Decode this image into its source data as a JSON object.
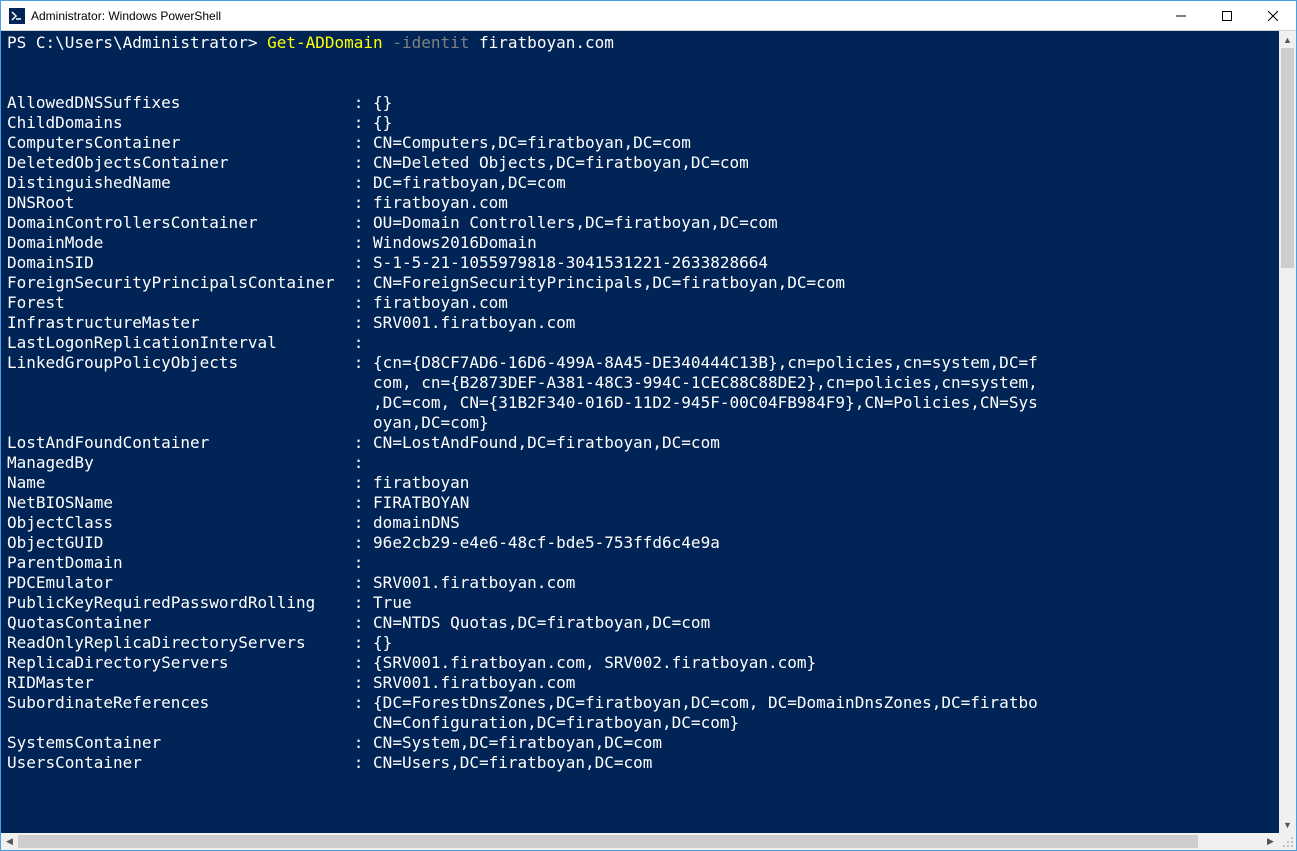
{
  "window": {
    "title": "Administrator: Windows PowerShell"
  },
  "prompt": {
    "prefix": "PS C:\\Users\\Administrator> ",
    "command": "Get-ADDomain",
    "param_flag": " -identit ",
    "argument": "firatboyan.com"
  },
  "properties": [
    {
      "name": "AllowedDNSSuffixes",
      "value": "{}"
    },
    {
      "name": "ChildDomains",
      "value": "{}"
    },
    {
      "name": "ComputersContainer",
      "value": "CN=Computers,DC=firatboyan,DC=com"
    },
    {
      "name": "DeletedObjectsContainer",
      "value": "CN=Deleted Objects,DC=firatboyan,DC=com"
    },
    {
      "name": "DistinguishedName",
      "value": "DC=firatboyan,DC=com"
    },
    {
      "name": "DNSRoot",
      "value": "firatboyan.com"
    },
    {
      "name": "DomainControllersContainer",
      "value": "OU=Domain Controllers,DC=firatboyan,DC=com"
    },
    {
      "name": "DomainMode",
      "value": "Windows2016Domain"
    },
    {
      "name": "DomainSID",
      "value": "S-1-5-21-1055979818-3041531221-2633828664"
    },
    {
      "name": "ForeignSecurityPrincipalsContainer",
      "value": "CN=ForeignSecurityPrincipals,DC=firatboyan,DC=com"
    },
    {
      "name": "Forest",
      "value": "firatboyan.com"
    },
    {
      "name": "InfrastructureMaster",
      "value": "SRV001.firatboyan.com"
    },
    {
      "name": "LastLogonReplicationInterval",
      "value": ""
    },
    {
      "name": "LinkedGroupPolicyObjects",
      "value": "{cn={D8CF7AD6-16D6-499A-8A45-DE340444C13B},cn=policies,cn=system,DC=f\n                                      com, cn={B2873DEF-A381-48C3-994C-1CEC88C88DE2},cn=policies,cn=system,\n                                      ,DC=com, CN={31B2F340-016D-11D2-945F-00C04FB984F9},CN=Policies,CN=Sys\n                                      oyan,DC=com}"
    },
    {
      "name": "LostAndFoundContainer",
      "value": "CN=LostAndFound,DC=firatboyan,DC=com"
    },
    {
      "name": "ManagedBy",
      "value": ""
    },
    {
      "name": "Name",
      "value": "firatboyan"
    },
    {
      "name": "NetBIOSName",
      "value": "FIRATBOYAN"
    },
    {
      "name": "ObjectClass",
      "value": "domainDNS"
    },
    {
      "name": "ObjectGUID",
      "value": "96e2cb29-e4e6-48cf-bde5-753ffd6c4e9a"
    },
    {
      "name": "ParentDomain",
      "value": ""
    },
    {
      "name": "PDCEmulator",
      "value": "SRV001.firatboyan.com"
    },
    {
      "name": "PublicKeyRequiredPasswordRolling",
      "value": "True"
    },
    {
      "name": "QuotasContainer",
      "value": "CN=NTDS Quotas,DC=firatboyan,DC=com"
    },
    {
      "name": "ReadOnlyReplicaDirectoryServers",
      "value": "{}"
    },
    {
      "name": "ReplicaDirectoryServers",
      "value": "{SRV001.firatboyan.com, SRV002.firatboyan.com}"
    },
    {
      "name": "RIDMaster",
      "value": "SRV001.firatboyan.com"
    },
    {
      "name": "SubordinateReferences",
      "value": "{DC=ForestDnsZones,DC=firatboyan,DC=com, DC=DomainDnsZones,DC=firatbo\n                                      CN=Configuration,DC=firatboyan,DC=com}"
    },
    {
      "name": "SystemsContainer",
      "value": "CN=System,DC=firatboyan,DC=com"
    },
    {
      "name": "UsersContainer",
      "value": "CN=Users,DC=firatboyan,DC=com"
    }
  ],
  "label_width": 36
}
